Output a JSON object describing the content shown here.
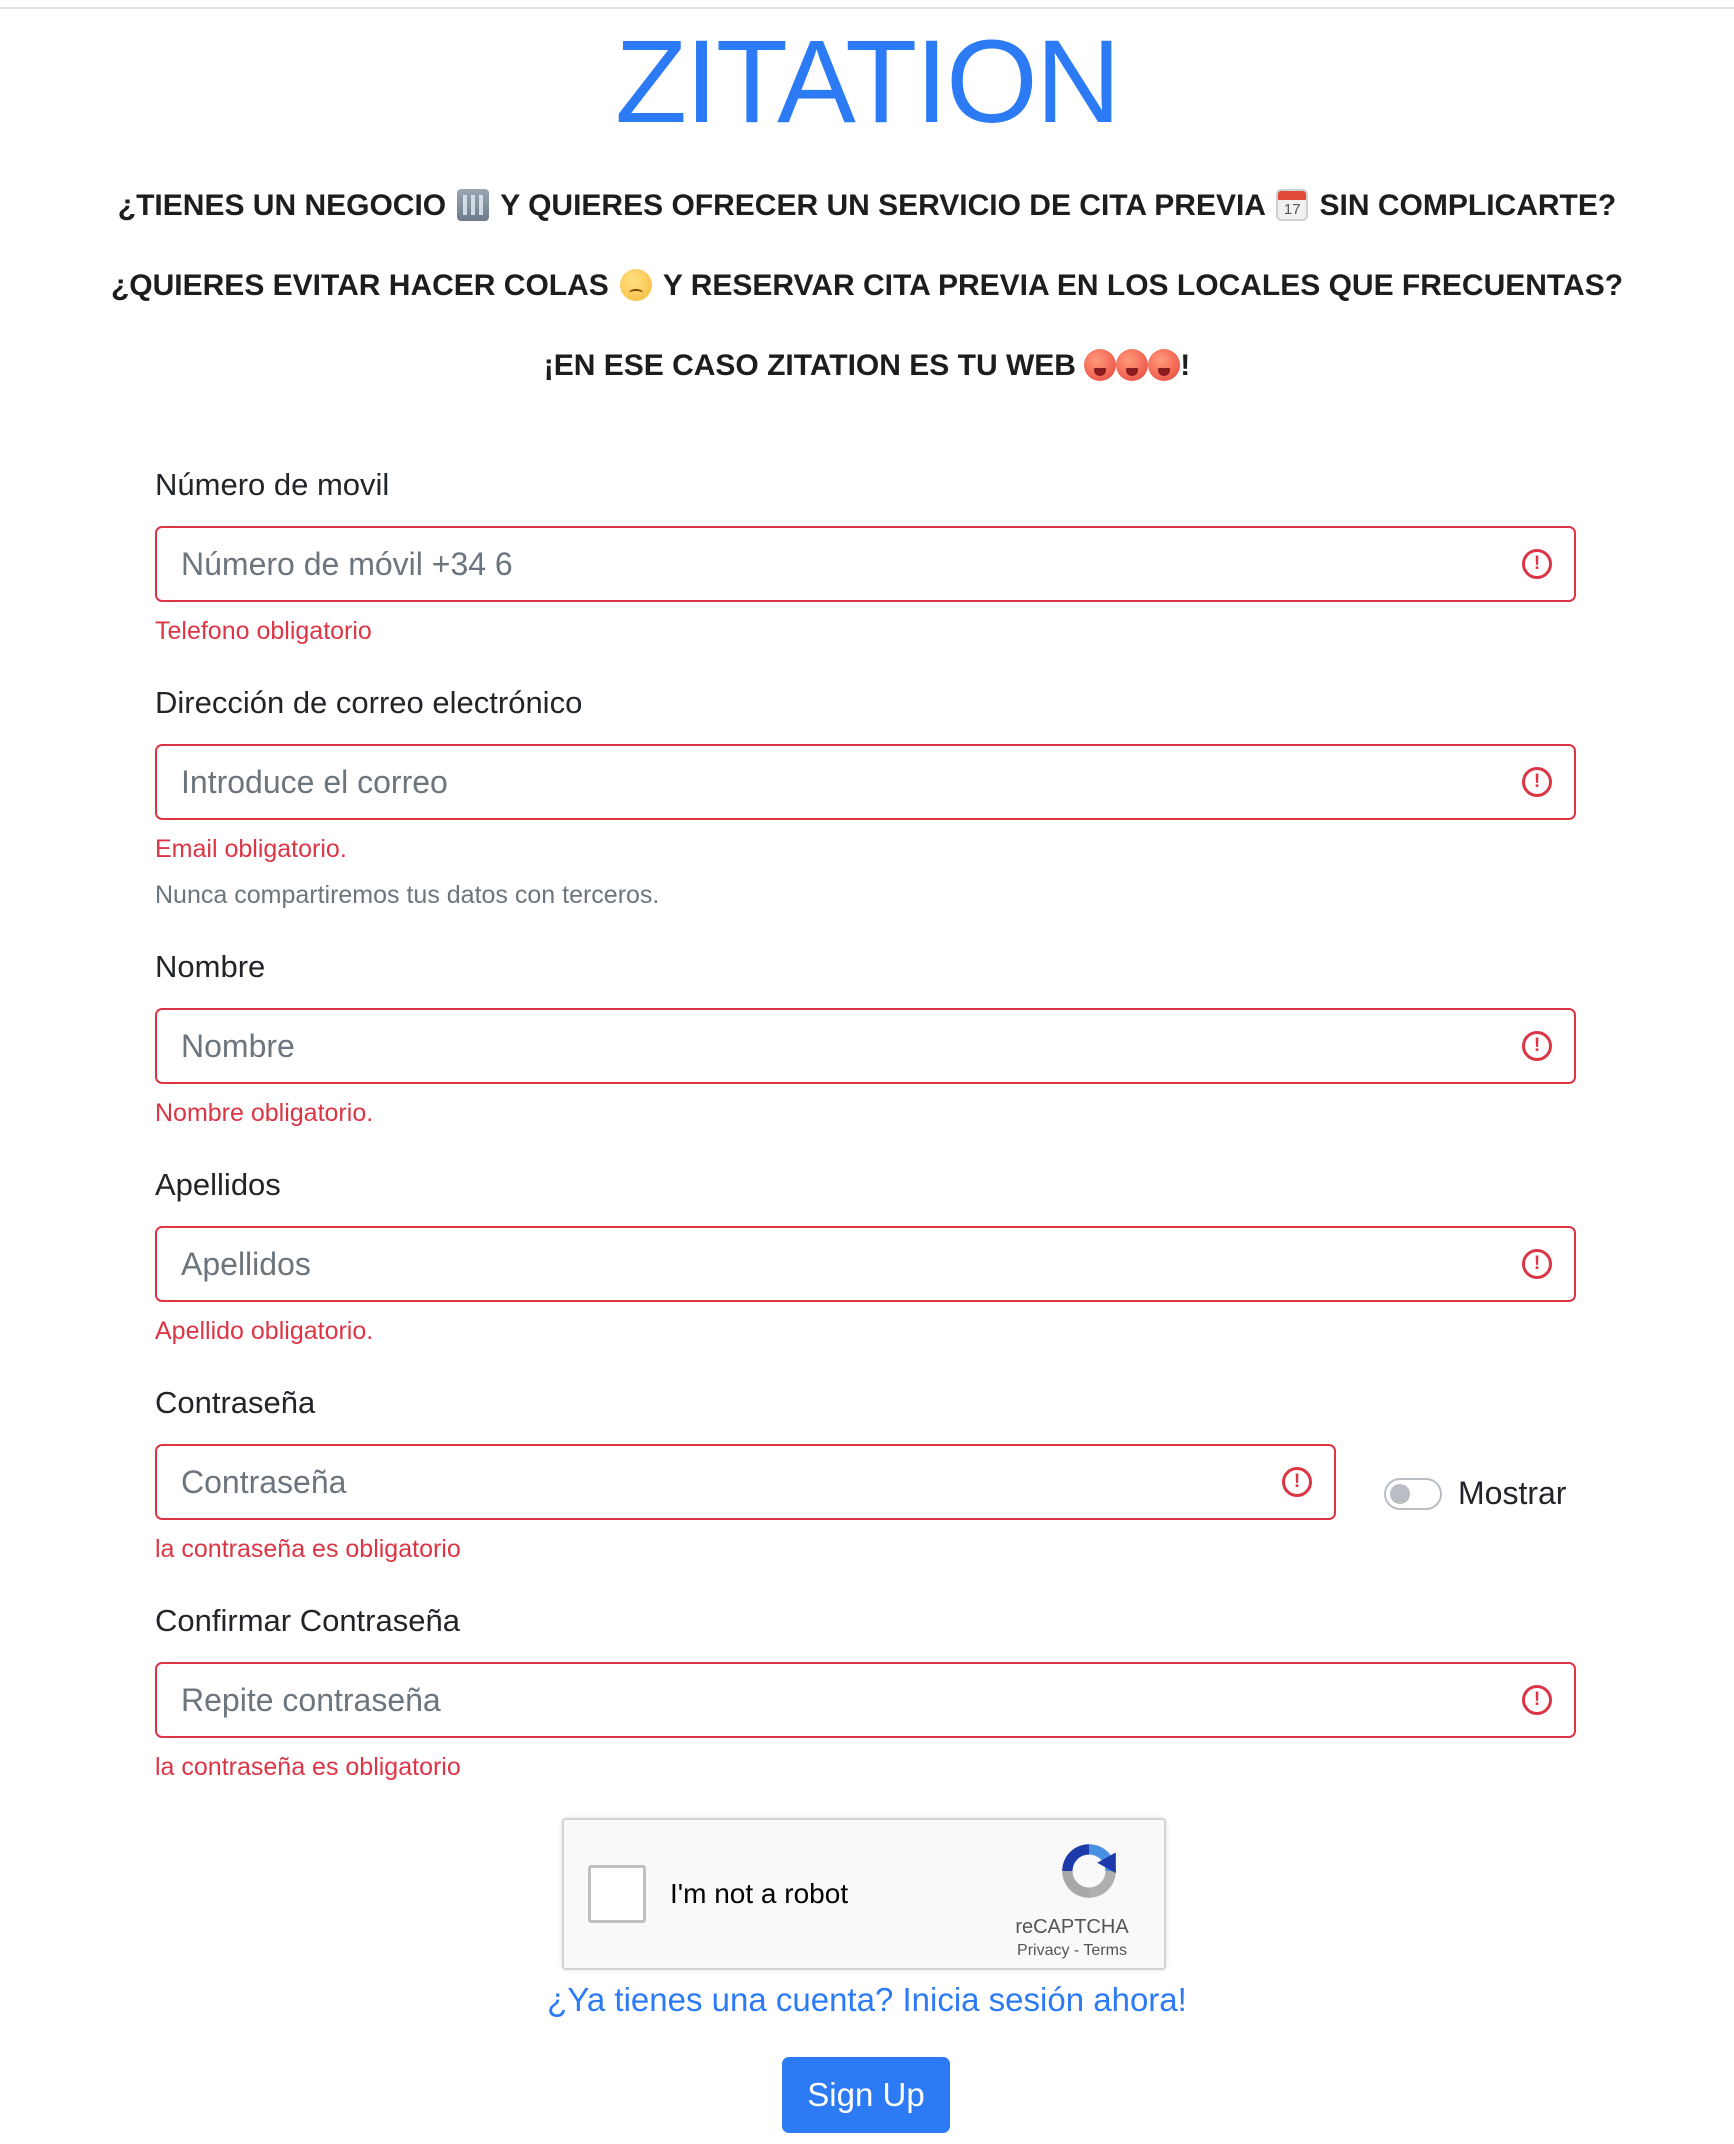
{
  "brand": "ZITATION",
  "taglines": {
    "line1_a": "¿TIENES UN NEGOCIO",
    "line1_b": "Y QUIERES OFRECER UN SERVICIO DE CITA PREVIA",
    "line1_c": "SIN COMPLICARTE?",
    "line2_a": "¿QUIERES EVITAR HACER COLAS",
    "line2_b": "Y RESERVAR CITA PREVIA EN LOS LOCALES QUE FRECUENTAS?",
    "line3_a": "¡EN ESE CASO ZITATION ES TU WEB",
    "line3_b": "!"
  },
  "form": {
    "phone": {
      "label": "Número de movil",
      "placeholder": "Número de móvil +34 6",
      "value": "",
      "error": "Telefono obligatorio"
    },
    "email": {
      "label": "Dirección de correo electrónico",
      "placeholder": "Introduce el correo",
      "value": "",
      "error": "Email obligatorio.",
      "help": "Nunca compartiremos tus datos con terceros."
    },
    "first_name": {
      "label": "Nombre",
      "placeholder": "Nombre",
      "value": "",
      "error": "Nombre obligatorio."
    },
    "last_name": {
      "label": "Apellidos",
      "placeholder": "Apellidos",
      "value": "",
      "error": "Apellido obligatorio."
    },
    "password": {
      "label": "Contraseña",
      "placeholder": "Contraseña",
      "value": "",
      "error": "la contraseña es obligatorio",
      "show_toggle_label": "Mostrar",
      "show_toggle_on": false
    },
    "confirm_password": {
      "label": "Confirmar Contraseña",
      "placeholder": "Repite contraseña",
      "value": "",
      "error": "la contraseña es obligatorio"
    }
  },
  "error_icon_glyph": "!",
  "recaptcha": {
    "checkbox_label": "I'm not a robot",
    "brand": "reCAPTCHA",
    "privacy": "Privacy",
    "separator": " - ",
    "terms": "Terms",
    "checked": false
  },
  "login_link": "¿Ya tienes una cuenta? Inicia sesión ahora!",
  "signup_button": "Sign Up",
  "colors": {
    "accent": "#2d7bf4",
    "error": "#dc3545",
    "muted": "#6c757d"
  },
  "icons": [
    "office-building-emoji-icon",
    "calendar-emoji-icon",
    "sad-sweat-face-emoji-icon",
    "hot-face-emoji-icon",
    "error-exclamation-icon",
    "recaptcha-logo-icon"
  ]
}
